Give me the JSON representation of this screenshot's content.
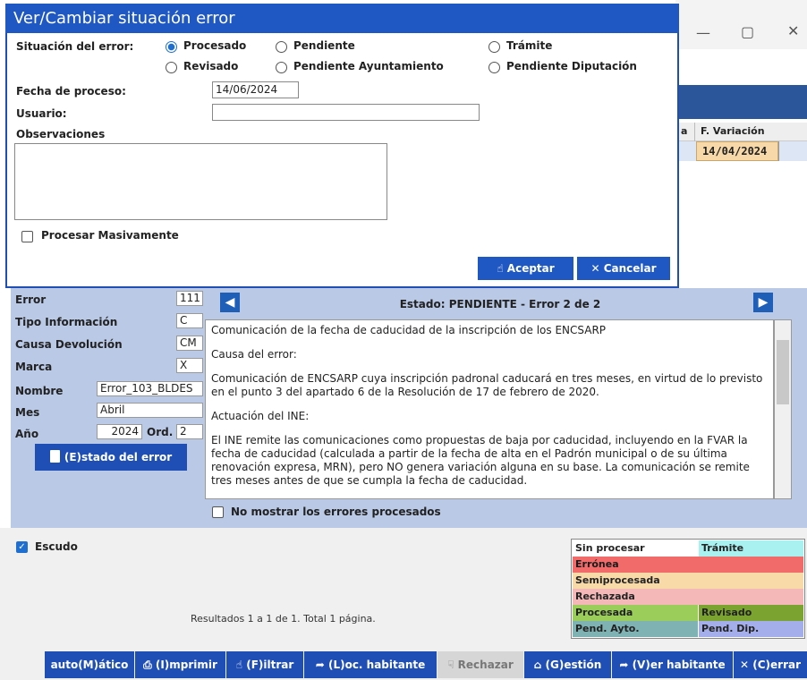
{
  "modal": {
    "title": "Ver/Cambiar situación error",
    "situacion_label": "Situación del error:",
    "options": [
      "Procesado",
      "Pendiente",
      "Trámite",
      "Revisado",
      "Pendiente Ayuntamiento",
      "Pendiente Diputación"
    ],
    "selected_option": "Procesado",
    "fecha_label": "Fecha de proceso:",
    "fecha_value": "14/06/2024",
    "usuario_label": "Usuario:",
    "usuario_value": "",
    "observaciones_label": "Observaciones",
    "observaciones_value": "",
    "masivo_label": "Procesar Masivamente",
    "masivo_checked": false,
    "accept_label": "Aceptar",
    "cancel_label": "Cancelar"
  },
  "background_grid": {
    "header_partial": "a",
    "header_variation": "F. Variación",
    "row_variation": "14/04/2024"
  },
  "error_panel": {
    "labels": {
      "error": "Error",
      "tipo": "Tipo Información",
      "causa": "Causa Devolución",
      "marca": "Marca",
      "nombre": "Nombre",
      "mes": "Mes",
      "anio": "Año",
      "ord": "Ord."
    },
    "values": {
      "error": "111",
      "tipo": "C",
      "causa": "CM",
      "marca": "X",
      "nombre": "Error_103_BLDES",
      "mes": "Abril",
      "anio": "2024",
      "ord": "2"
    },
    "estado_button": "(E)stado del error",
    "status_text": "Estado: PENDIENTE - Error 2 de 2",
    "description": [
      "Comunicación de la fecha de caducidad de la inscripción de los ENCSARP",
      "Causa del error:",
      "Comunicación de ENCSARP cuya inscripción padronal caducará en tres meses, en virtud de lo previsto en el punto 3 del apartado 6 de la Resolución de 17 de febrero de 2020.",
      "Actuación del INE:",
      "El INE remite las comunicaciones como propuestas de baja por caducidad, incluyendo en la FVAR la fecha de caducidad (calculada a partir de la fecha de alta en el Padrón municipal o de su última renovación expresa, MRN), pero NO genera variación alguna en su base. La comunicación se remite tres meses antes de que se cumpla la fecha de caducidad."
    ],
    "hide_processed_label": "No mostrar los errores procesados",
    "hide_processed_checked": false
  },
  "bottom": {
    "escudo_label": "Escudo",
    "escudo_checked": true,
    "results_text": "Resultados 1 a 1 de 1. Total 1 página.",
    "legend": {
      "sin_procesar": {
        "label": "Sin procesar",
        "color": "#ffffff"
      },
      "tramite": {
        "label": "Trámite",
        "color": "#a9f0f0"
      },
      "erronea": {
        "label": "Errónea",
        "color": "#f26b6b"
      },
      "semiprocesada": {
        "label": "Semiprocesada",
        "color": "#f8d9a8"
      },
      "rechazada": {
        "label": "Rechazada",
        "color": "#f5b8b8"
      },
      "procesada": {
        "label": "Procesada",
        "color": "#9acd5a"
      },
      "revisado": {
        "label": "Revisado",
        "color": "#7aa32f"
      },
      "pend_ayto": {
        "label": "Pend. Ayto.",
        "color": "#7fb3b3"
      },
      "pend_dip": {
        "label": "Pend. Dip.",
        "color": "#a3aeea"
      }
    }
  },
  "toolbar": {
    "automatico": "auto(M)ático",
    "imprimir": "(I)mprimir",
    "filtrar": "(F)iltrar",
    "loc_habitante": "(L)oc. habitante",
    "rechazar": "Rechazar",
    "gestion": "(G)estión",
    "ver_habitante": "(V)er habitante",
    "cerrar": "(C)errar"
  },
  "colors": {
    "accent": "#1f57c3",
    "panel": "#b9c9e6"
  }
}
